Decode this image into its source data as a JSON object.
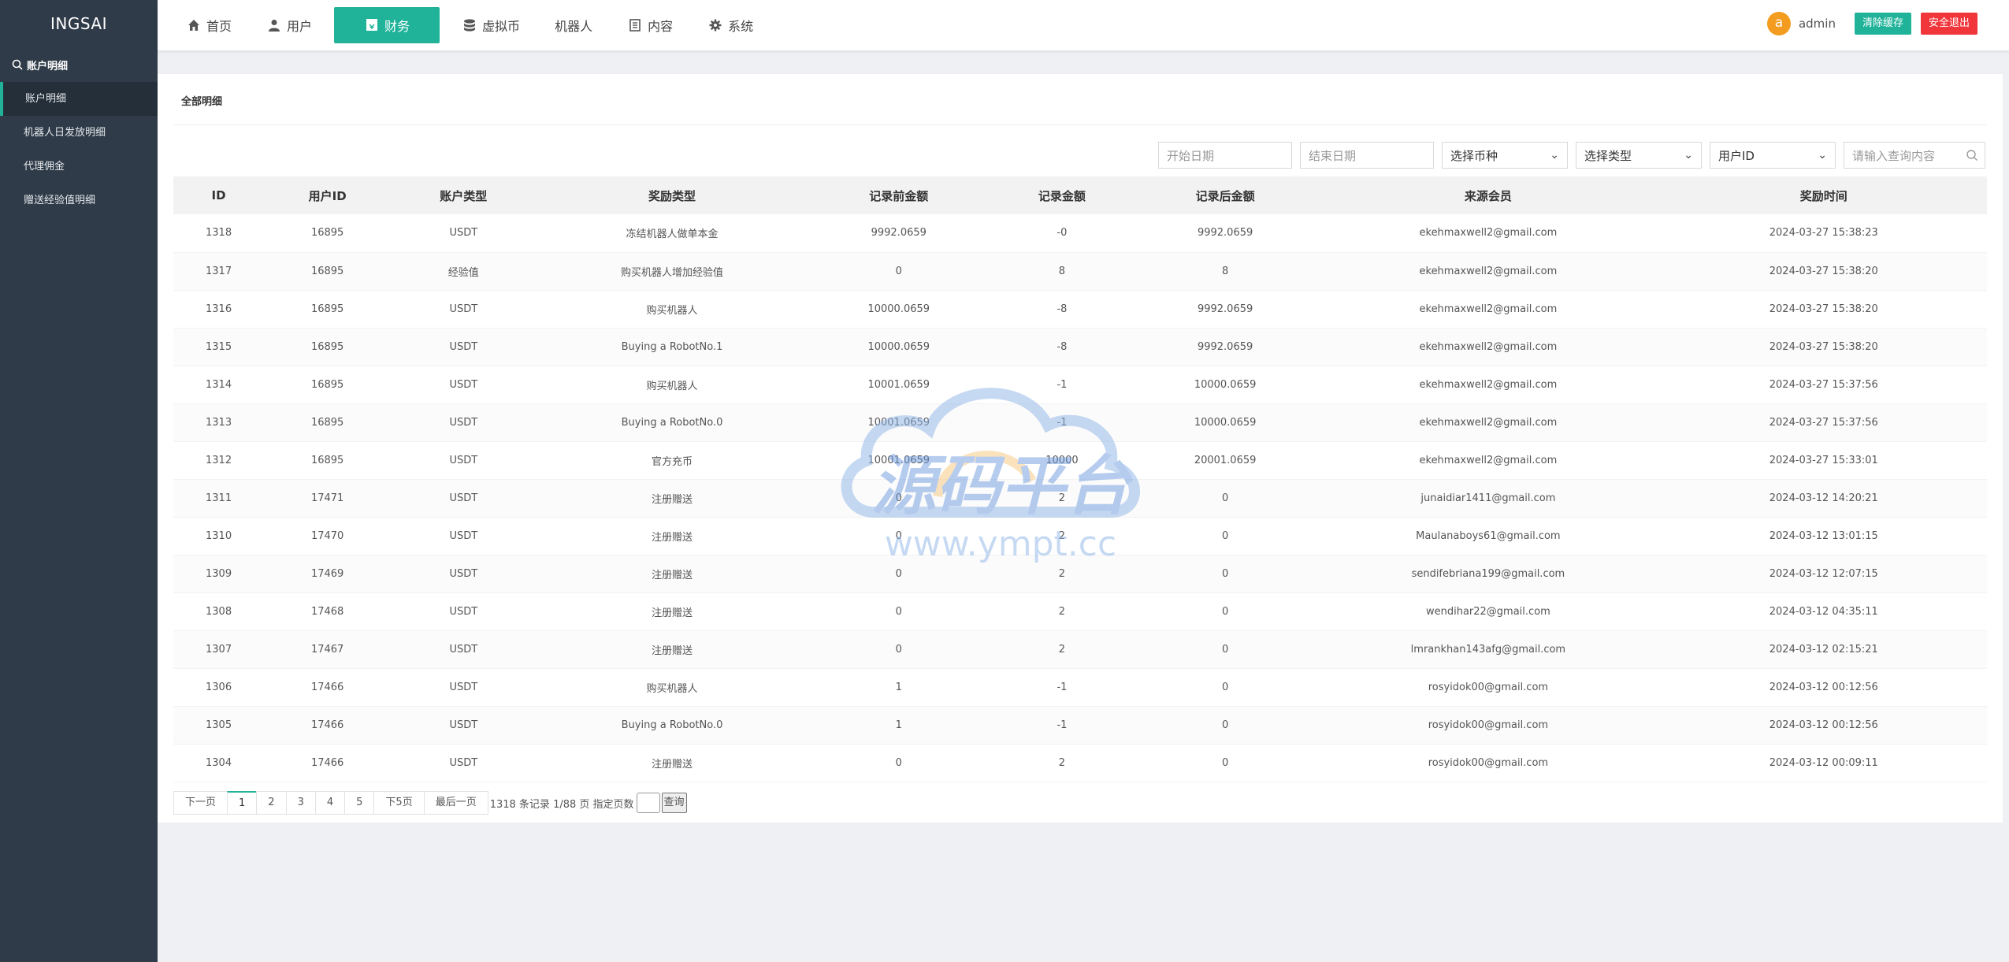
{
  "sidebar": {
    "logo": "INGSAI",
    "section": {
      "label": "账户明细",
      "icon": "search-icon"
    },
    "items": [
      {
        "label": "账户明细",
        "active": true
      },
      {
        "label": "机器人日发放明细",
        "active": false
      },
      {
        "label": "代理佣金",
        "active": false
      },
      {
        "label": "赠送经验值明细",
        "active": false
      }
    ]
  },
  "nav": {
    "items": [
      {
        "label": "首页",
        "icon": "home-icon"
      },
      {
        "label": "用户",
        "icon": "user-icon"
      },
      {
        "label": "财务",
        "icon": "finance-icon",
        "active": true
      },
      {
        "label": "虚拟币",
        "icon": "database-icon"
      },
      {
        "label": "机器人",
        "icon": ""
      },
      {
        "label": "内容",
        "icon": "document-icon"
      },
      {
        "label": "系统",
        "icon": "gear-icon"
      }
    ]
  },
  "user": {
    "avatar": "a",
    "name": "admin",
    "clear_cache": "清除缓存",
    "logout": "安全退出"
  },
  "panel": {
    "title": "全部明细"
  },
  "filters": {
    "start_date": "开始日期",
    "end_date": "结束日期",
    "currency": "选择币种",
    "type": "选择类型",
    "field": "用户ID",
    "search": "请输入查询内容"
  },
  "table": {
    "headers": [
      "ID",
      "用户ID",
      "账户类型",
      "奖励类型",
      "记录前金额",
      "记录金额",
      "记录后金额",
      "来源会员",
      "奖励时间"
    ],
    "rows": [
      [
        "1318",
        "16895",
        "USDT",
        "冻结机器人做单本金",
        "9992.0659",
        "-0",
        "9992.0659",
        "ekehmaxwell2@gmail.com",
        "2024-03-27 15:38:23"
      ],
      [
        "1317",
        "16895",
        "经验值",
        "购买机器人增加经验值",
        "0",
        "8",
        "8",
        "ekehmaxwell2@gmail.com",
        "2024-03-27 15:38:20"
      ],
      [
        "1316",
        "16895",
        "USDT",
        "购买机器人",
        "10000.0659",
        "-8",
        "9992.0659",
        "ekehmaxwell2@gmail.com",
        "2024-03-27 15:38:20"
      ],
      [
        "1315",
        "16895",
        "USDT",
        "Buying a RobotNo.1",
        "10000.0659",
        "-8",
        "9992.0659",
        "ekehmaxwell2@gmail.com",
        "2024-03-27 15:38:20"
      ],
      [
        "1314",
        "16895",
        "USDT",
        "购买机器人",
        "10001.0659",
        "-1",
        "10000.0659",
        "ekehmaxwell2@gmail.com",
        "2024-03-27 15:37:56"
      ],
      [
        "1313",
        "16895",
        "USDT",
        "Buying a RobotNo.0",
        "10001.0659",
        "-1",
        "10000.0659",
        "ekehmaxwell2@gmail.com",
        "2024-03-27 15:37:56"
      ],
      [
        "1312",
        "16895",
        "USDT",
        "官方充币",
        "10001.0659",
        "10000",
        "20001.0659",
        "ekehmaxwell2@gmail.com",
        "2024-03-27 15:33:01"
      ],
      [
        "1311",
        "17471",
        "USDT",
        "注册赠送",
        "0",
        "2",
        "0",
        "junaidiar1411@gmail.com",
        "2024-03-12 14:20:21"
      ],
      [
        "1310",
        "17470",
        "USDT",
        "注册赠送",
        "0",
        "2",
        "0",
        "Maulanaboys61@gmail.com",
        "2024-03-12 13:01:15"
      ],
      [
        "1309",
        "17469",
        "USDT",
        "注册赠送",
        "0",
        "2",
        "0",
        "sendifebriana199@gmail.com",
        "2024-03-12 12:07:15"
      ],
      [
        "1308",
        "17468",
        "USDT",
        "注册赠送",
        "0",
        "2",
        "0",
        "wendihar22@gmail.com",
        "2024-03-12 04:35:11"
      ],
      [
        "1307",
        "17467",
        "USDT",
        "注册赠送",
        "0",
        "2",
        "0",
        "lmrankhan143afg@gmail.com",
        "2024-03-12 02:15:21"
      ],
      [
        "1306",
        "17466",
        "USDT",
        "购买机器人",
        "1",
        "-1",
        "0",
        "rosyidok00@gmail.com",
        "2024-03-12 00:12:56"
      ],
      [
        "1305",
        "17466",
        "USDT",
        "Buying a RobotNo.0",
        "1",
        "-1",
        "0",
        "rosyidok00@gmail.com",
        "2024-03-12 00:12:56"
      ],
      [
        "1304",
        "17466",
        "USDT",
        "注册赠送",
        "0",
        "2",
        "0",
        "rosyidok00@gmail.com",
        "2024-03-12 00:09:11"
      ]
    ]
  },
  "pagination": {
    "prev": "下一页",
    "pages": [
      "1",
      "2",
      "3",
      "4",
      "5"
    ],
    "current": "1",
    "next5": "下5页",
    "last": "最后一页",
    "info": "1318 条记录 1/88 页 指定页数",
    "go": "查询"
  },
  "watermark": {
    "title": "源码平台",
    "url": "www.ympt.cc"
  },
  "colors": {
    "accent": "#20b39a",
    "danger": "#f0353b",
    "sidebar": "#2f3b48",
    "avatar": "#f39c1f"
  }
}
